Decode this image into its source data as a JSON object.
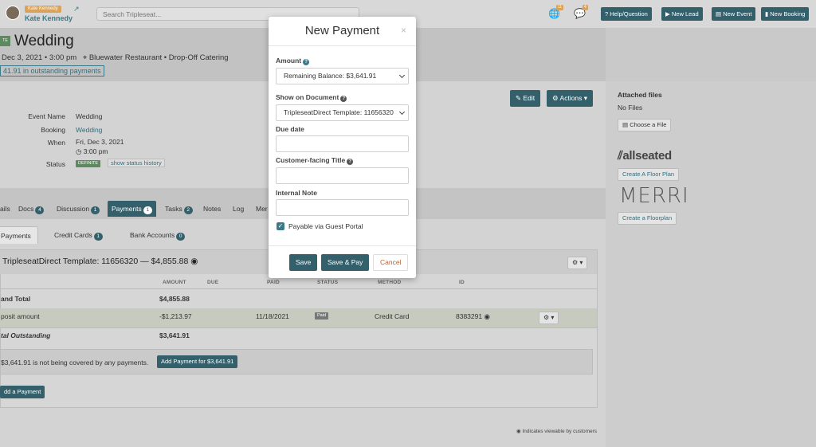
{
  "topbar": {
    "user_badge": "Kate Kennedy",
    "user_name": "Kate Kennedy",
    "search_placeholder": "Search Tripleseat...",
    "notif1_count": "11",
    "notif2_count": "4",
    "buttons": [
      "Help/Question",
      "New Lead",
      "New Event",
      "New Booking"
    ]
  },
  "header": {
    "status_tag": "TE",
    "title": "Wedding",
    "date": "Dec 3, 2021 • 3:00 pm",
    "location": "Bluewater Restaurant • Drop-Off Catering",
    "outstanding": "41.91 in outstanding payments"
  },
  "details": {
    "event_name_label": "Event Name",
    "event_name": "Wedding",
    "booking_label": "Booking",
    "booking": "Wedding",
    "when_label": "When",
    "when_date": "Fri, Dec 3, 2021",
    "when_time": "3:00 pm",
    "status_label": "Status",
    "status_value": "DEFINITE",
    "status_history": "show status history",
    "edit_label": "Edit",
    "actions_label": "Actions"
  },
  "sidebar": {
    "attached_title": "Attached files",
    "no_files": "No Files",
    "choose_file": "Choose a File",
    "allseated_logo": "allseated",
    "floor_plan_btn": "Create A Floor Plan",
    "merri_logo": "MERRI",
    "floorplan_btn": "Create a Floorplan"
  },
  "tabs": [
    {
      "label": "ails",
      "count": ""
    },
    {
      "label": "Docs",
      "count": "4"
    },
    {
      "label": "Discussion",
      "count": "1"
    },
    {
      "label": "Payments",
      "count": "1"
    },
    {
      "label": "Tasks",
      "count": "2"
    },
    {
      "label": "Notes",
      "count": ""
    },
    {
      "label": "Log",
      "count": ""
    },
    {
      "label": "Mer",
      "count": ""
    }
  ],
  "subtabs": [
    {
      "label": "Payments",
      "count": ""
    },
    {
      "label": "Credit Cards",
      "count": "1"
    },
    {
      "label": "Bank Accounts",
      "count": "0"
    }
  ],
  "panel": {
    "title": "TripleseatDirect Template: 11656320 — $4,855.88",
    "columns": [
      "AMOUNT",
      "DUE",
      "PAID",
      "STATUS",
      "METHOD",
      "ID"
    ],
    "grand_total_label": "and Total",
    "grand_total_value": "$4,855.88",
    "deposit_label": "posit amount",
    "deposit_amount": "-$1,213.97",
    "deposit_paid": "11/18/2021",
    "deposit_status": "Paid",
    "deposit_method": "Credit Card",
    "deposit_id": "8383291",
    "outstanding_label": "tal Outstanding",
    "outstanding_value": "$3,641.91",
    "notice_text": "$3,641.91 is not being covered by any payments.",
    "add_payment_for": "Add Payment for $3,641.91",
    "add_payment": "dd a Payment",
    "footnote": "Indicates viewable by customers"
  },
  "modal": {
    "title": "New Payment",
    "close": "×",
    "amount_label": "Amount",
    "amount_value": "Remaining Balance: $3,641.91",
    "document_label": "Show on Document",
    "document_value": "TripleseatDirect Template: 11656320",
    "due_label": "Due date",
    "due_value": "",
    "title_label": "Customer-facing Title",
    "title_value": "",
    "note_label": "Internal Note",
    "note_value": "",
    "payable_label": "Payable via Guest Portal",
    "save": "Save",
    "save_pay": "Save & Pay",
    "cancel": "Cancel"
  },
  "colors": {
    "teal_dark": "#33606a",
    "teal_link": "#2f6e7e",
    "badge_gold": "#d9a35c",
    "definite_green": "#5c8a5e",
    "cancel_orange": "#c0602b"
  }
}
